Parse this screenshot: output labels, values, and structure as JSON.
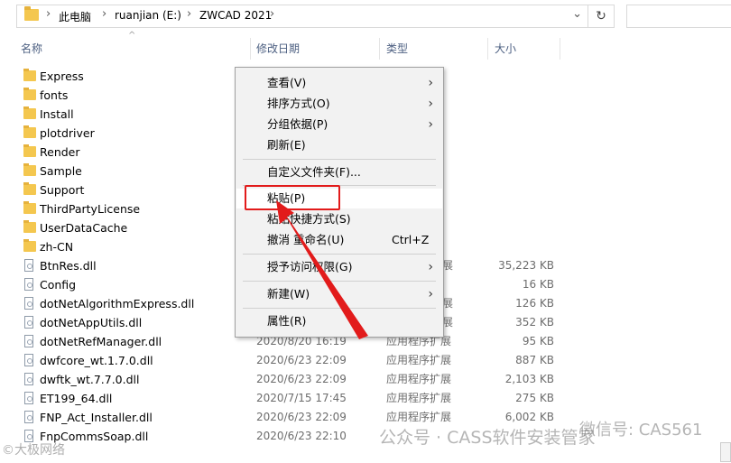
{
  "address": {
    "path": [
      "此电脑",
      "ruanjian (E:)",
      "ZWCAD 2021"
    ]
  },
  "columns": {
    "name": "名称",
    "date": "修改日期",
    "type": "类型",
    "size": "大小"
  },
  "folders": [
    "Express",
    "fonts",
    "Install",
    "plotdriver",
    "Render",
    "Sample",
    "Support",
    "ThirdPartyLicense",
    "UserDataCache",
    "zh-CN"
  ],
  "files": [
    {
      "name": "BtnRes.dll",
      "date": "",
      "type": "展",
      "size": "35,223 KB"
    },
    {
      "name": "Config",
      "date": "",
      "type": "",
      "size": "16 KB"
    },
    {
      "name": "dotNetAlgorithmExpress.dll",
      "date": "",
      "type": "展",
      "size": "126 KB"
    },
    {
      "name": "dotNetAppUtils.dll",
      "date": "",
      "type": "展",
      "size": "352 KB"
    },
    {
      "name": "dotNetRefManager.dll",
      "date": "2020/8/20 16:19",
      "type": "应用程序扩展",
      "size": "95 KB"
    },
    {
      "name": "dwfcore_wt.1.7.0.dll",
      "date": "2020/6/23 22:09",
      "type": "应用程序扩展",
      "size": "887 KB"
    },
    {
      "name": "dwftk_wt.7.7.0.dll",
      "date": "2020/6/23 22:09",
      "type": "应用程序扩展",
      "size": "2,103 KB"
    },
    {
      "name": "ET199_64.dll",
      "date": "2020/7/15 17:45",
      "type": "应用程序扩展",
      "size": "275 KB"
    },
    {
      "name": "FNP_Act_Installer.dll",
      "date": "2020/6/23 22:09",
      "type": "应用程序扩展",
      "size": "6,002 KB"
    },
    {
      "name": "FnpCommsSoap.dll",
      "date": "2020/6/23 22:10",
      "type": "",
      "size": ""
    }
  ],
  "context_menu": {
    "view": "查看(V)",
    "sort": "排序方式(O)",
    "group": "分组依据(P)",
    "refresh": "刷新(E)",
    "customize": "自定义文件夹(F)...",
    "paste": "粘贴(P)",
    "paste_shortcut": "粘贴快捷方式(S)",
    "undo": "撤消 重命名(U)",
    "undo_shortcut": "Ctrl+Z",
    "access": "授予访问权限(G)",
    "new": "新建(W)",
    "properties": "属性(R)"
  },
  "watermark": {
    "right": "公众号 · CASS软件安装管家",
    "right2": "微信号: CAS561",
    "left": "©大极网络"
  },
  "colors": {
    "accent": "#e21b1b",
    "folder": "#f4c74f",
    "header_text": "#4d6082"
  }
}
